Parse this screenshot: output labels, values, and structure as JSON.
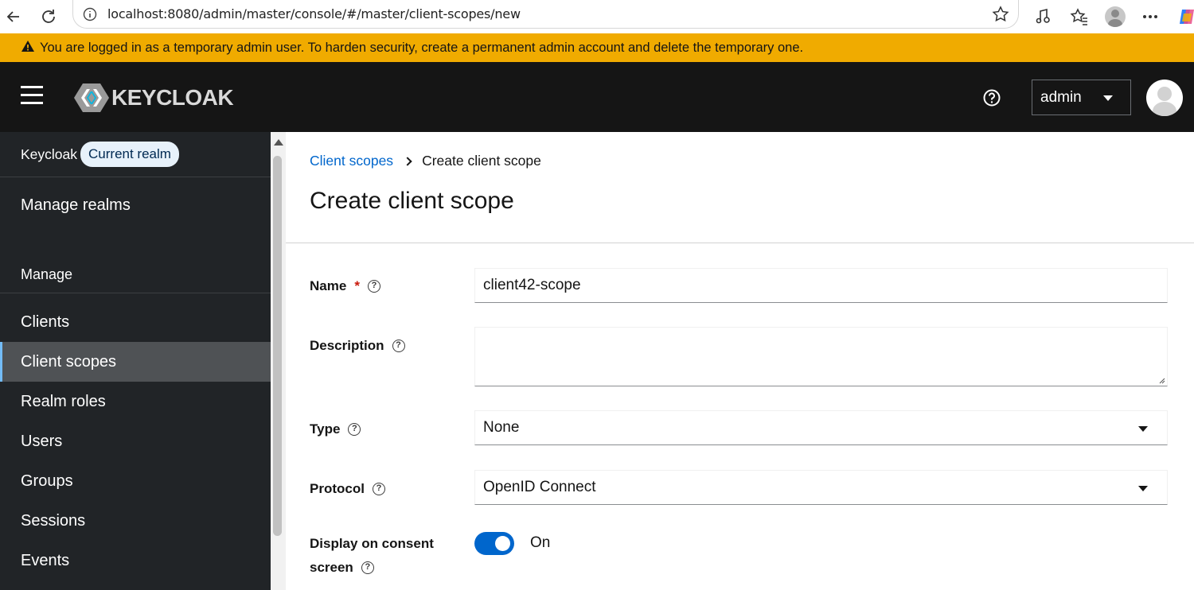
{
  "browser": {
    "url": "localhost:8080/admin/master/console/#/master/client-scopes/new"
  },
  "banner": {
    "text": "You are logged in as a temporary admin user. To harden security, create a permanent admin account and delete the temporary one."
  },
  "masthead": {
    "logo_text": "KEYCLOAK",
    "user": "admin"
  },
  "sidebar": {
    "realm": "Keycloak",
    "realm_badge": "Current realm",
    "manage_realms": "Manage realms",
    "section": "Manage",
    "items": [
      {
        "label": "Clients"
      },
      {
        "label": "Client scopes"
      },
      {
        "label": "Realm roles"
      },
      {
        "label": "Users"
      },
      {
        "label": "Groups"
      },
      {
        "label": "Sessions"
      },
      {
        "label": "Events"
      }
    ]
  },
  "main": {
    "breadcrumb": {
      "parent": "Client scopes",
      "current": "Create client scope"
    },
    "title": "Create client scope",
    "form": {
      "name_label": "Name",
      "name_required": "*",
      "name_value": "client42-scope",
      "description_label": "Description",
      "description_value": "",
      "type_label": "Type",
      "type_value": "None",
      "protocol_label": "Protocol",
      "protocol_value": "OpenID Connect",
      "consent_label_line1": "Display on consent",
      "consent_label_line2": "screen",
      "consent_state": "On"
    }
  },
  "colors": {
    "banner": "#f0ab00",
    "masthead": "#151515",
    "sidebar": "#212427",
    "link": "#0066cc",
    "switch_on": "#0066cc"
  }
}
